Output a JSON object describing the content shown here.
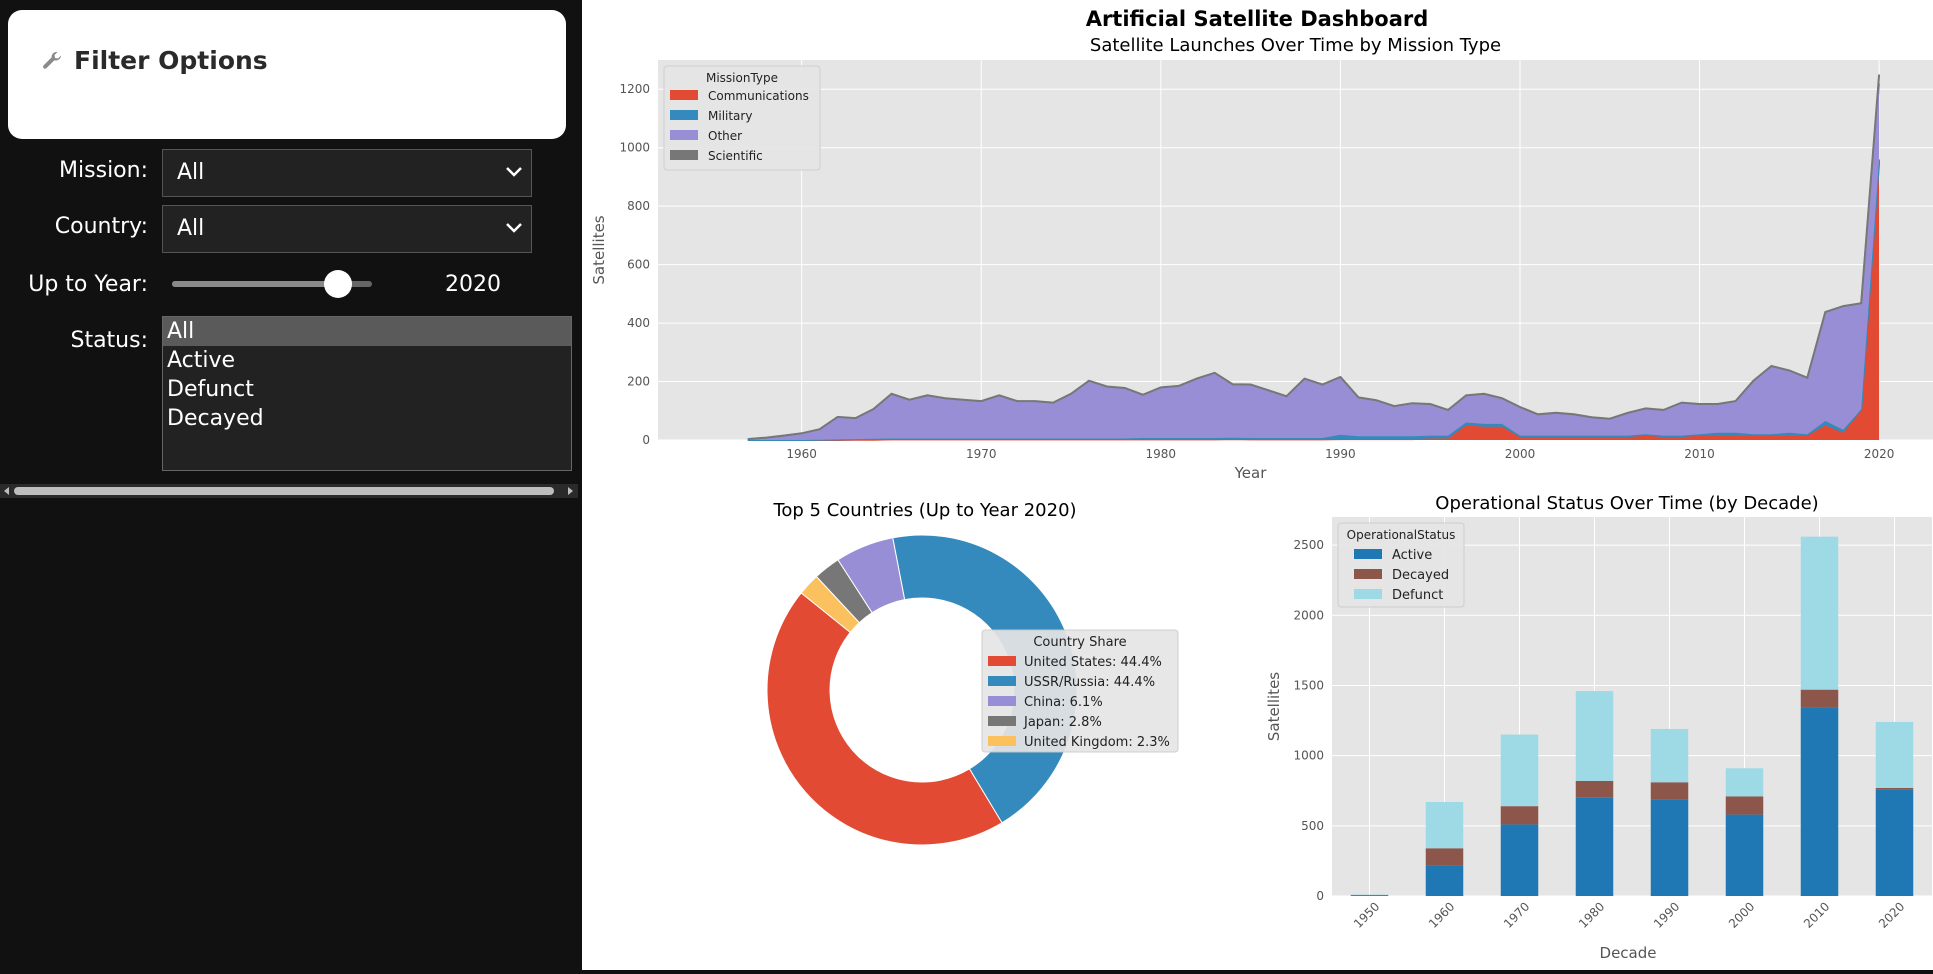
{
  "sidebar": {
    "title": "Filter Options",
    "title_icon": "wrench-icon",
    "mission": {
      "label": "Mission:",
      "value": "All"
    },
    "country": {
      "label": "Country:",
      "value": "All"
    },
    "year": {
      "label": "Up to Year:",
      "value": "2020",
      "fraction": 0.83
    },
    "status": {
      "label": "Status:",
      "options": [
        "All",
        "Active",
        "Defunct",
        "Decayed"
      ],
      "selected": "All"
    }
  },
  "dashboard": {
    "title": "Artificial Satellite Dashboard"
  },
  "colors": {
    "communications": "#e24a33",
    "military": "#348abd",
    "other": "#988ed5",
    "scientific": "#777777",
    "japan": "#777777",
    "uk": "#fbc15e",
    "active": "#1f77b4",
    "decayed": "#8c564b",
    "defunct": "#9edae5",
    "plot_bg": "#e5e5e5"
  },
  "chart_data": [
    {
      "type": "area",
      "title": "Satellite Launches Over Time by Mission Type",
      "xlabel": "Year",
      "ylabel": "Satellites",
      "xlim": [
        1952,
        2023
      ],
      "ylim": [
        0,
        1300
      ],
      "xticks": [
        1960,
        1970,
        1980,
        1990,
        2000,
        2010,
        2020
      ],
      "yticks": [
        0,
        200,
        400,
        600,
        800,
        1000,
        1200
      ],
      "legend_title": "MissionType",
      "legend_position": "top-left",
      "grid": true,
      "x": [
        1957,
        1958,
        1959,
        1960,
        1961,
        1962,
        1963,
        1964,
        1965,
        1966,
        1967,
        1968,
        1969,
        1970,
        1971,
        1972,
        1973,
        1974,
        1975,
        1976,
        1977,
        1978,
        1979,
        1980,
        1981,
        1982,
        1983,
        1984,
        1985,
        1986,
        1987,
        1988,
        1989,
        1990,
        1991,
        1992,
        1993,
        1994,
        1995,
        1996,
        1997,
        1998,
        1999,
        2000,
        2001,
        2002,
        2003,
        2004,
        2005,
        2006,
        2007,
        2008,
        2009,
        2010,
        2011,
        2012,
        2013,
        2014,
        2015,
        2016,
        2017,
        2018,
        2019,
        2020
      ],
      "series": [
        {
          "name": "Communications",
          "values": [
            0,
            0,
            0,
            0,
            0,
            0,
            1,
            1,
            2,
            2,
            2,
            2,
            2,
            2,
            2,
            2,
            2,
            2,
            2,
            2,
            2,
            2,
            2,
            2,
            2,
            2,
            2,
            3,
            2,
            2,
            2,
            2,
            2,
            3,
            3,
            3,
            3,
            3,
            5,
            5,
            50,
            45,
            45,
            10,
            10,
            10,
            10,
            10,
            10,
            10,
            15,
            10,
            10,
            15,
            15,
            15,
            15,
            15,
            15,
            15,
            50,
            25,
            100,
            950
          ]
        },
        {
          "name": "Military",
          "values": [
            0,
            0,
            0,
            0,
            1,
            2,
            2,
            3,
            3,
            3,
            3,
            3,
            3,
            3,
            3,
            3,
            3,
            3,
            3,
            3,
            3,
            3,
            5,
            5,
            5,
            5,
            5,
            5,
            5,
            5,
            5,
            5,
            5,
            15,
            10,
            10,
            10,
            10,
            10,
            10,
            10,
            10,
            10,
            5,
            5,
            5,
            5,
            5,
            5,
            5,
            5,
            5,
            5,
            5,
            10,
            10,
            5,
            5,
            10,
            5,
            15,
            10,
            5,
            10
          ]
        },
        {
          "name": "Other",
          "values": [
            3,
            8,
            15,
            22,
            35,
            75,
            70,
            100,
            150,
            130,
            145,
            135,
            130,
            125,
            145,
            125,
            125,
            120,
            150,
            195,
            175,
            170,
            145,
            170,
            175,
            200,
            220,
            180,
            180,
            160,
            140,
            200,
            180,
            195,
            130,
            120,
            100,
            110,
            105,
            85,
            90,
            100,
            85,
            95,
            70,
            75,
            70,
            60,
            55,
            75,
            85,
            85,
            110,
            100,
            95,
            105,
            180,
            230,
            210,
            190,
            370,
            420,
            360,
            260
          ]
        },
        {
          "name": "Scientific",
          "values": [
            0,
            0,
            0,
            1,
            1,
            2,
            2,
            2,
            3,
            3,
            3,
            3,
            3,
            3,
            3,
            3,
            3,
            3,
            3,
            3,
            3,
            3,
            3,
            3,
            3,
            3,
            3,
            3,
            3,
            3,
            3,
            3,
            3,
            3,
            3,
            3,
            3,
            3,
            3,
            3,
            3,
            3,
            3,
            3,
            3,
            3,
            3,
            3,
            3,
            3,
            3,
            3,
            3,
            3,
            3,
            3,
            3,
            3,
            3,
            3,
            3,
            3,
            3,
            30
          ]
        }
      ]
    },
    {
      "type": "pie",
      "title": "Top 5 Countries (Up to Year 2020)",
      "legend_title": "Country Share",
      "legend_position": "right",
      "categories": [
        "United States",
        "USSR/Russia",
        "China",
        "Japan",
        "United Kingdom"
      ],
      "values": [
        44.4,
        44.4,
        6.1,
        2.8,
        2.3
      ],
      "labels": [
        "United States: 44.4%",
        "USSR/Russia: 44.4%",
        "China: 6.1%",
        "Japan: 2.8%",
        "United Kingdom: 2.3%"
      ]
    },
    {
      "type": "bar",
      "stacked": true,
      "title": "Operational Status Over Time (by Decade)",
      "xlabel": "Decade",
      "ylabel": "Satellites",
      "ylim": [
        0,
        2700
      ],
      "yticks": [
        0,
        500,
        1000,
        1500,
        2000,
        2500
      ],
      "legend_title": "OperationalStatus",
      "legend_position": "top-left",
      "grid": true,
      "categories": [
        "1950",
        "1960",
        "1970",
        "1980",
        "1990",
        "2000",
        "2010",
        "2020"
      ],
      "series": [
        {
          "name": "Active",
          "values": [
            5,
            220,
            510,
            700,
            690,
            580,
            1340,
            760
          ]
        },
        {
          "name": "Decayed",
          "values": [
            2,
            120,
            130,
            120,
            120,
            130,
            130,
            10
          ]
        },
        {
          "name": "Defunct",
          "values": [
            3,
            330,
            510,
            640,
            380,
            200,
            1090,
            470
          ]
        }
      ]
    }
  ]
}
